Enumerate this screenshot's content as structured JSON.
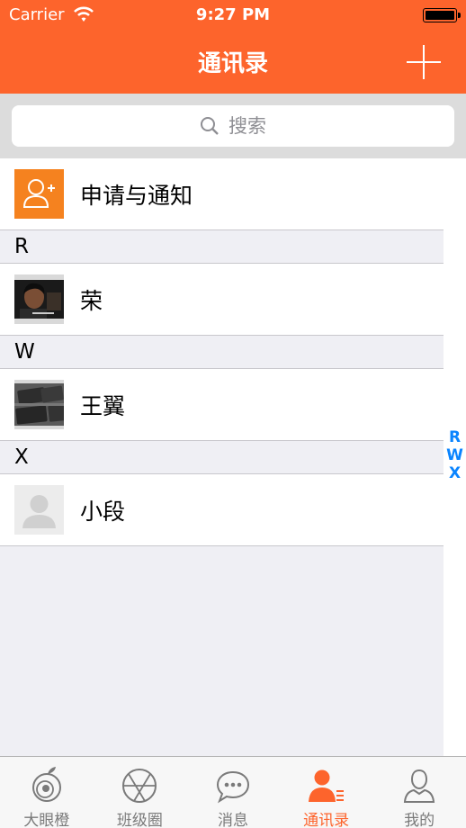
{
  "status_bar": {
    "carrier": "Carrier",
    "time": "9:27 PM"
  },
  "nav": {
    "title": "通讯录",
    "add_icon": "plus-icon"
  },
  "search": {
    "placeholder": "搜索"
  },
  "contacts": {
    "notification_row": {
      "label": "申请与通知",
      "icon": "add-friend-icon",
      "color": "#f5821f"
    },
    "sections": [
      {
        "letter": "R",
        "contacts": [
          {
            "name": "荣"
          }
        ]
      },
      {
        "letter": "W",
        "contacts": [
          {
            "name": "王翼"
          }
        ]
      },
      {
        "letter": "X",
        "contacts": [
          {
            "name": "小段"
          }
        ]
      }
    ]
  },
  "index_bar": [
    "R",
    "W",
    "X"
  ],
  "tabbar": {
    "accent_color": "#fd642c",
    "tabs": [
      {
        "label": "大眼橙",
        "icon": "orange-icon",
        "active": false
      },
      {
        "label": "班级圈",
        "icon": "aperture-icon",
        "active": false
      },
      {
        "label": "消息",
        "icon": "chat-bubble-icon",
        "active": false
      },
      {
        "label": "通讯录",
        "icon": "contacts-icon",
        "active": true
      },
      {
        "label": "我的",
        "icon": "person-icon",
        "active": false
      }
    ]
  }
}
